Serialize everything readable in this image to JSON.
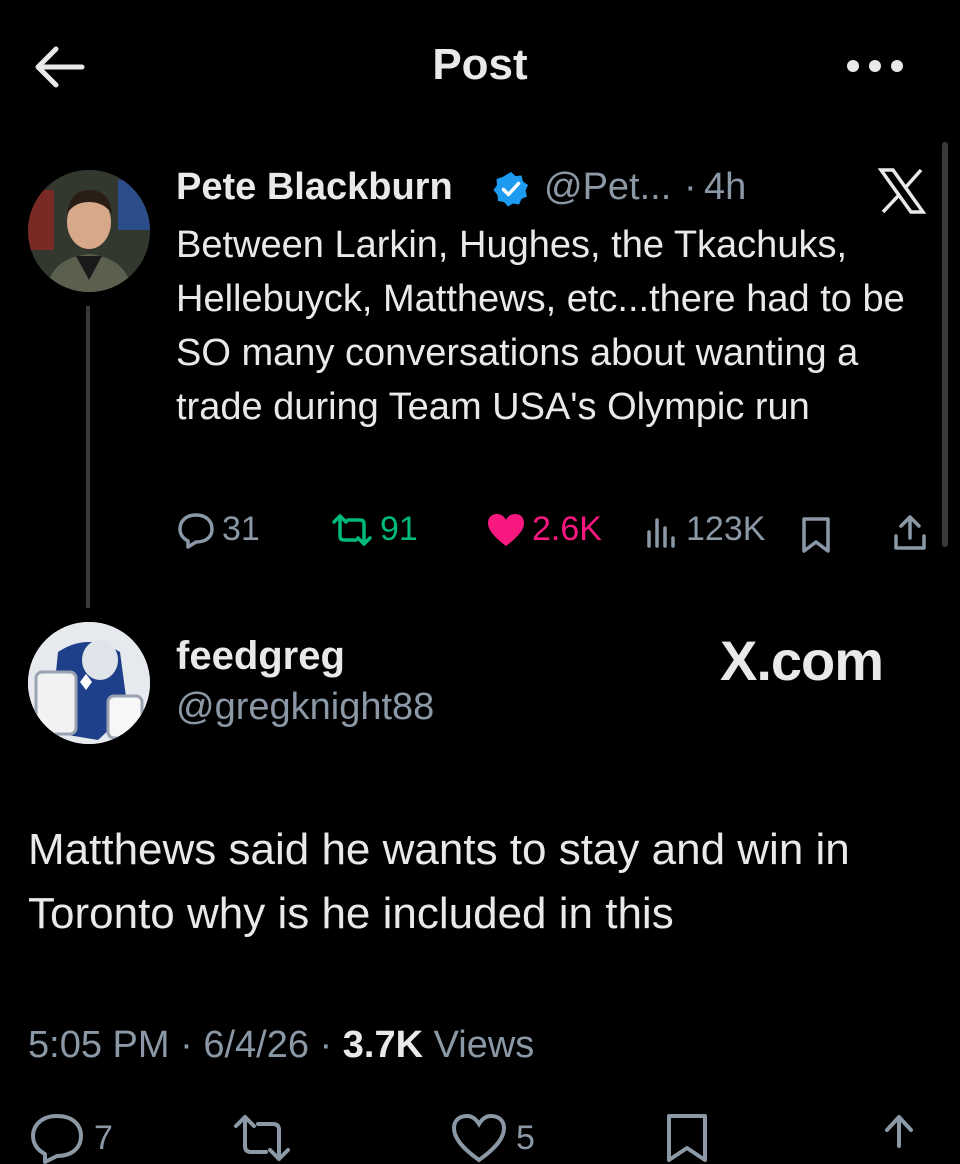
{
  "header": {
    "title": "Post",
    "back_icon": "arrow-left-icon",
    "more_icon": "more-dots-icon"
  },
  "quoted_post": {
    "name": "Pete Blackburn",
    "handle": "@Pet...",
    "separator": "·",
    "time": "4h",
    "verified": true,
    "text": "Between Larkin, Hughes, the Tkachuks, Hellebuyck, Matthews, etc...there had to be SO many conversations about wanting a trade during Team USA's Olympic run",
    "stats": {
      "replies": "31",
      "reposts": "91",
      "likes": "2.6K",
      "views": "123K"
    }
  },
  "reply_post": {
    "name": "feedgreg",
    "handle": "@gregknight88",
    "watermark": "X.com",
    "text": "Matthews said he wants to stay and win in Toronto why is he included in this",
    "time": "5:05 PM",
    "sep1": "·",
    "date": "6/4/26",
    "sep2": "·",
    "views_count": "3.7K",
    "views_label": "Views",
    "stats": {
      "replies": "7",
      "likes": "5"
    }
  },
  "colors": {
    "background": "#000000",
    "text": "#e7e9ea",
    "muted": "#8b98a5",
    "repost": "#00ba7c",
    "like": "#f91880",
    "verified": "#1d9bf0"
  }
}
